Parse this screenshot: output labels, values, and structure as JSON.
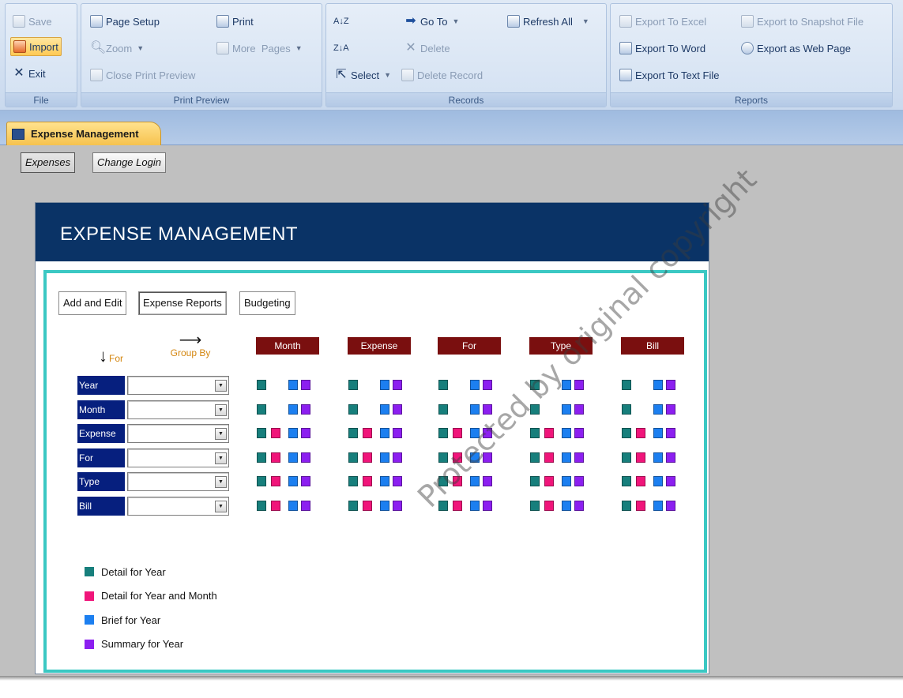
{
  "ribbon": {
    "file": {
      "label": "File",
      "save": "Save",
      "import": "Import",
      "exit": "Exit"
    },
    "print_preview": {
      "label": "Print Preview",
      "page_setup": "Page Setup",
      "print": "Print",
      "zoom": "Zoom",
      "more_pages": "More  Pages",
      "close_preview": "Close Print Preview"
    },
    "records": {
      "label": "Records",
      "sort_asc": "A↓Z",
      "sort_desc": "Z↓A",
      "go_to": "Go To",
      "refresh_all": "Refresh All",
      "delete": "Delete",
      "select": "Select",
      "delete_record": "Delete Record"
    },
    "reports": {
      "label": "Reports",
      "export_excel": "Export To Excel",
      "export_snapshot": "Export to Snapshot File",
      "export_word": "Export To Word",
      "export_web": "Export as Web Page",
      "export_text": "Export To Text File"
    }
  },
  "document_tab": {
    "label": "Expense Management"
  },
  "nav": {
    "expenses": "Expenses",
    "change_login": "Change Login"
  },
  "panel": {
    "title": "EXPENSE MANAGEMENT",
    "tabs": [
      "Add and Edit",
      "Expense Reports",
      "Budgeting"
    ],
    "for_label": "For",
    "group_by_label": "Group By",
    "columns": [
      "Month",
      "Expense",
      "For",
      "Type",
      "Bill"
    ],
    "rows": [
      {
        "label": "Year",
        "value": "",
        "buttons": [
          "teal",
          "blue",
          "purple"
        ]
      },
      {
        "label": "Month",
        "value": "",
        "buttons": [
          "teal",
          "blue",
          "purple"
        ]
      },
      {
        "label": "Expense",
        "value": "",
        "buttons": [
          "teal",
          "pink",
          "blue",
          "purple"
        ]
      },
      {
        "label": "For",
        "value": "",
        "buttons": [
          "teal",
          "pink",
          "blue",
          "purple"
        ]
      },
      {
        "label": "Type",
        "value": "",
        "buttons": [
          "teal",
          "pink",
          "blue",
          "purple"
        ]
      },
      {
        "label": "Bill",
        "value": "",
        "buttons": [
          "teal",
          "pink",
          "blue",
          "purple"
        ]
      }
    ],
    "legend": [
      {
        "color": "#177f7c",
        "label": "Detail for Year"
      },
      {
        "color": "#f0157a",
        "label": "Detail for Year and Month"
      },
      {
        "color": "#1c7ff0",
        "label": "Brief for Year"
      },
      {
        "color": "#8c1ff0",
        "label": "Summary for Year"
      }
    ]
  },
  "colors": {
    "teal": "#177f7c",
    "pink": "#f0157a",
    "blue": "#1c7ff0",
    "purple": "#8c1ff0"
  },
  "watermark": "Protected by original copyright"
}
